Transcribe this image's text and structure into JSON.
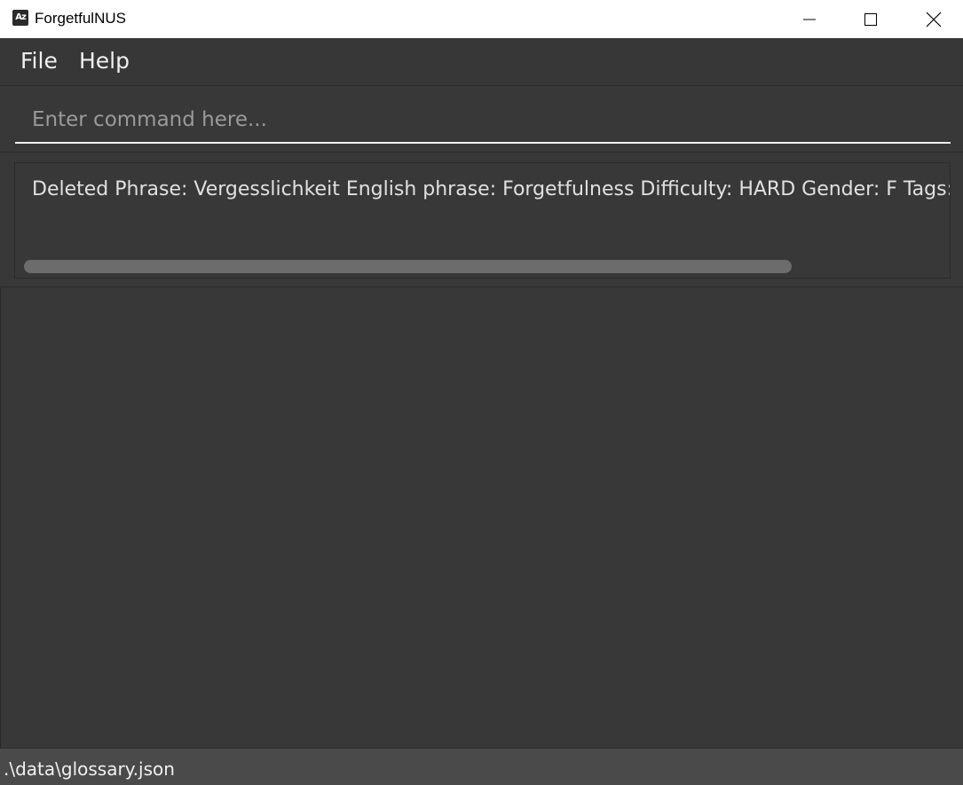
{
  "window": {
    "title": "ForgetfulNUS",
    "icon_text": "Az",
    "controls": [
      "minimize-icon",
      "maximize-icon",
      "close-icon"
    ]
  },
  "menu": {
    "items": [
      {
        "label": "File"
      },
      {
        "label": "Help"
      }
    ]
  },
  "command": {
    "value": "",
    "placeholder": "Enter command here..."
  },
  "result": {
    "text": "Deleted Phrase: Vergesslichkeit English phrase: Forgetfulness Difficulty: HARD Gender: F Tags: [c"
  },
  "status": {
    "path": ".\\data\\glossary.json"
  },
  "colors": {
    "background": "#383838",
    "titlebar": "#ffffff",
    "statusbar": "#4a4a4a",
    "text": "#f0f0f0",
    "scroll_thumb": "#6c6c6c"
  }
}
